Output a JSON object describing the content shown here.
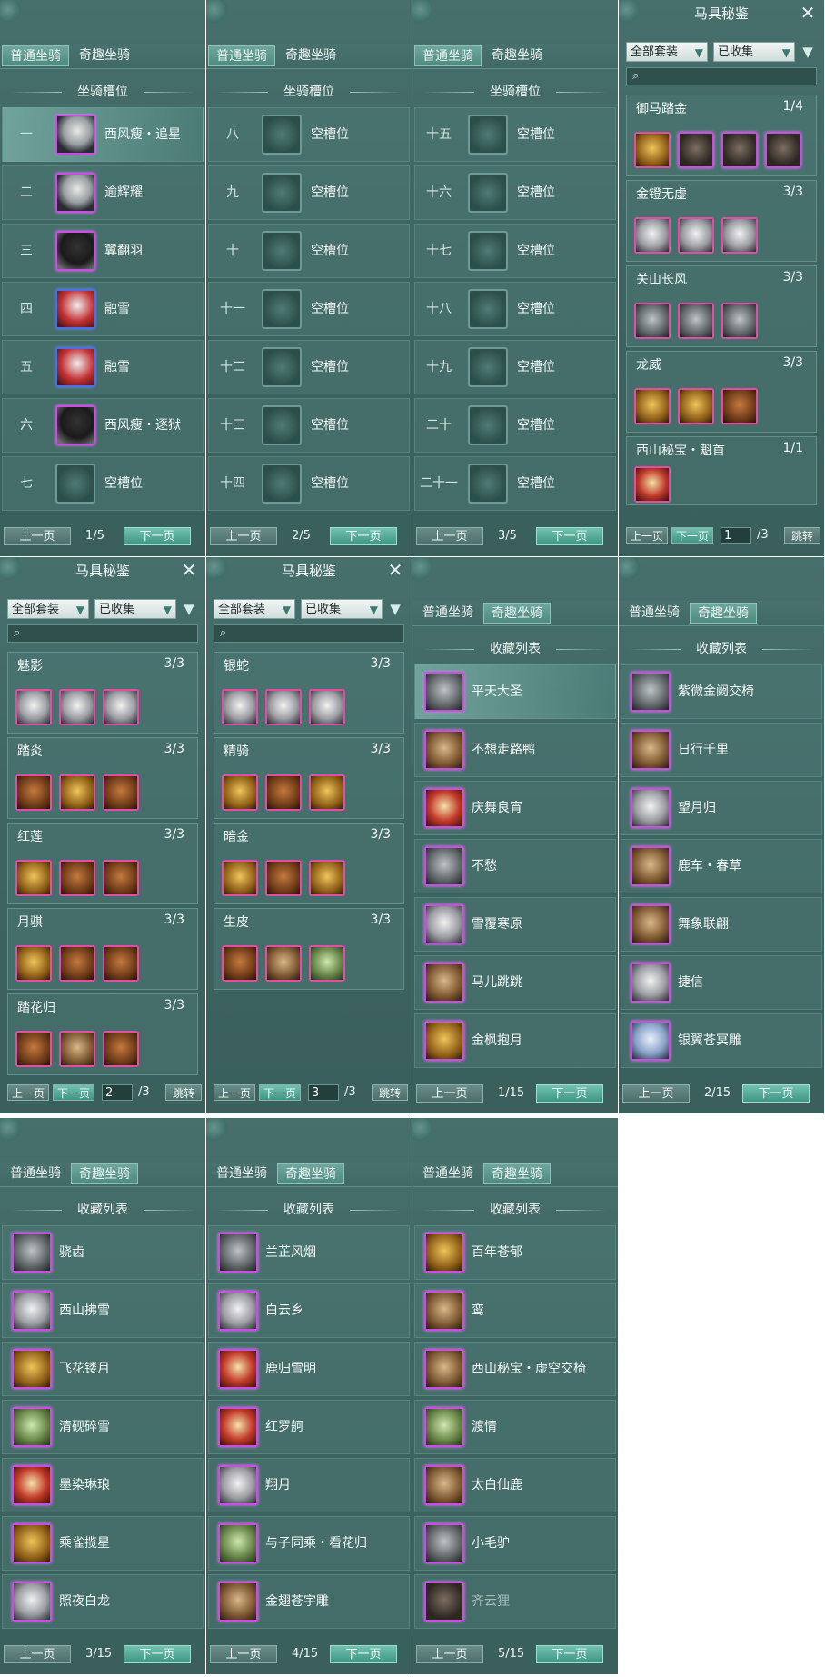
{
  "tabs": {
    "normal": "普通坐骑",
    "special": "奇趣坐骑"
  },
  "slot_title": "坐骑槽位",
  "collection_title": "收藏列表",
  "codex_title": "马具秘鉴",
  "pager": {
    "prev": "上一页",
    "next": "下一页",
    "jump": "跳转"
  },
  "filters": {
    "set": "全部套装",
    "owned": "已收集"
  },
  "slot_pages": [
    {
      "page": "1/5",
      "rows": [
        {
          "idx": "一",
          "name": "西风瘦・追星",
          "icon": "horse-w",
          "frame": "purple"
        },
        {
          "idx": "二",
          "name": "逾辉耀",
          "icon": "horse-w",
          "frame": "purple"
        },
        {
          "idx": "三",
          "name": "翼翻羽",
          "icon": "horse-b",
          "frame": "purple"
        },
        {
          "idx": "四",
          "name": "融雪",
          "icon": "horse-r",
          "frame": "blue"
        },
        {
          "idx": "五",
          "name": "融雪",
          "icon": "horse-r",
          "frame": "blue"
        },
        {
          "idx": "六",
          "name": "西风瘦・逐狱",
          "icon": "horse-b",
          "frame": "purple"
        },
        {
          "idx": "七",
          "name": "空槽位",
          "icon": "empty",
          "frame": "empty"
        }
      ]
    },
    {
      "page": "2/5",
      "rows": [
        {
          "idx": "八",
          "name": "空槽位",
          "icon": "empty",
          "frame": "empty"
        },
        {
          "idx": "九",
          "name": "空槽位",
          "icon": "empty",
          "frame": "empty"
        },
        {
          "idx": "十",
          "name": "空槽位",
          "icon": "empty",
          "frame": "empty"
        },
        {
          "idx": "十一",
          "name": "空槽位",
          "icon": "empty",
          "frame": "empty"
        },
        {
          "idx": "十二",
          "name": "空槽位",
          "icon": "empty",
          "frame": "empty"
        },
        {
          "idx": "十三",
          "name": "空槽位",
          "icon": "empty",
          "frame": "empty"
        },
        {
          "idx": "十四",
          "name": "空槽位",
          "icon": "empty",
          "frame": "empty"
        }
      ]
    },
    {
      "page": "3/5",
      "rows": [
        {
          "idx": "十五",
          "name": "空槽位",
          "icon": "empty",
          "frame": "empty"
        },
        {
          "idx": "十六",
          "name": "空槽位",
          "icon": "empty",
          "frame": "empty"
        },
        {
          "idx": "十七",
          "name": "空槽位",
          "icon": "empty",
          "frame": "empty"
        },
        {
          "idx": "十八",
          "name": "空槽位",
          "icon": "empty",
          "frame": "empty"
        },
        {
          "idx": "十九",
          "name": "空槽位",
          "icon": "empty",
          "frame": "empty"
        },
        {
          "idx": "二十",
          "name": "空槽位",
          "icon": "empty",
          "frame": "empty"
        },
        {
          "idx": "二十一",
          "name": "空槽位",
          "icon": "empty",
          "frame": "empty"
        }
      ]
    }
  ],
  "codex_pages": [
    {
      "page_input": "1",
      "total": "/3",
      "sets": [
        {
          "name": "御马踏金",
          "count": "1/4",
          "items": [
            "gold",
            "dark",
            "dark",
            "dark"
          ]
        },
        {
          "name": "金镫无虚",
          "count": "3/3",
          "items": [
            "silver",
            "silver",
            "silver"
          ]
        },
        {
          "name": "关山长风",
          "count": "3/3",
          "items": [
            "grey",
            "grey",
            "grey"
          ]
        },
        {
          "name": "龙威",
          "count": "3/3",
          "items": [
            "gold",
            "gold",
            "leather"
          ]
        },
        {
          "name": "西山秘宝・魁首",
          "count": "1/1",
          "items": [
            "red"
          ]
        }
      ]
    },
    {
      "page_input": "2",
      "total": "/3",
      "sets": [
        {
          "name": "魅影",
          "count": "3/3",
          "items": [
            "silver",
            "silver",
            "silver"
          ]
        },
        {
          "name": "踏炎",
          "count": "3/3",
          "items": [
            "leather",
            "gold",
            "leather"
          ]
        },
        {
          "name": "红莲",
          "count": "3/3",
          "items": [
            "gold",
            "leather",
            "leather"
          ]
        },
        {
          "name": "月骐",
          "count": "3/3",
          "items": [
            "gold",
            "leather",
            "leather"
          ]
        },
        {
          "name": "踏花归",
          "count": "3/3",
          "items": [
            "leather",
            "brown",
            "leather"
          ]
        }
      ]
    },
    {
      "page_input": "3",
      "total": "/3",
      "sets": [
        {
          "name": "银蛇",
          "count": "3/3",
          "items": [
            "silver",
            "silver",
            "silver"
          ]
        },
        {
          "name": "精骑",
          "count": "3/3",
          "items": [
            "gold",
            "leather",
            "gold"
          ]
        },
        {
          "name": "暗金",
          "count": "3/3",
          "items": [
            "gold",
            "leather",
            "gold"
          ]
        },
        {
          "name": "生皮",
          "count": "3/3",
          "items": [
            "leather",
            "brown",
            "green"
          ]
        }
      ]
    }
  ],
  "collection_pages": [
    {
      "page": "1/15",
      "rows": [
        {
          "name": "平天大圣",
          "icon": "grey"
        },
        {
          "name": "不想走路鸭",
          "icon": "brown"
        },
        {
          "name": "庆舞良宵",
          "icon": "red"
        },
        {
          "name": "不愁",
          "icon": "grey"
        },
        {
          "name": "雪覆寒原",
          "icon": "silver"
        },
        {
          "name": "马儿跳跳",
          "icon": "brown"
        },
        {
          "name": "金枫抱月",
          "icon": "gold"
        }
      ]
    },
    {
      "page": "2/15",
      "rows": [
        {
          "name": "紫微金阙交椅",
          "icon": "grey"
        },
        {
          "name": "日行千里",
          "icon": "brown"
        },
        {
          "name": "望月归",
          "icon": "silver"
        },
        {
          "name": "鹿车・春草",
          "icon": "brown"
        },
        {
          "name": "舞象联翩",
          "icon": "brown"
        },
        {
          "name": "捷信",
          "icon": "silver"
        },
        {
          "name": "银翼苍冥雕",
          "icon": "blue"
        }
      ]
    },
    {
      "page": "3/15",
      "rows": [
        {
          "name": "骁齿",
          "icon": "grey"
        },
        {
          "name": "西山拂雪",
          "icon": "silver"
        },
        {
          "name": "飞花镂月",
          "icon": "gold"
        },
        {
          "name": "清砚碎雪",
          "icon": "green"
        },
        {
          "name": "墨染琳琅",
          "icon": "red"
        },
        {
          "name": "乘雀揽星",
          "icon": "gold"
        },
        {
          "name": "照夜白龙",
          "icon": "silver"
        }
      ]
    },
    {
      "page": "4/15",
      "rows": [
        {
          "name": "兰芷风烟",
          "icon": "grey"
        },
        {
          "name": "白云乡",
          "icon": "silver"
        },
        {
          "name": "鹿归雪明",
          "icon": "red"
        },
        {
          "name": "红罗舸",
          "icon": "red"
        },
        {
          "name": "翔月",
          "icon": "silver"
        },
        {
          "name": "与子同乘・看花归",
          "icon": "green"
        },
        {
          "name": "金翅苍宇雕",
          "icon": "brown"
        }
      ]
    },
    {
      "page": "5/15",
      "rows": [
        {
          "name": "百年苍郁",
          "icon": "gold"
        },
        {
          "name": "鸾",
          "icon": "brown"
        },
        {
          "name": "西山秘宝・虚空交椅",
          "icon": "brown"
        },
        {
          "name": "渡情",
          "icon": "green"
        },
        {
          "name": "太白仙鹿",
          "icon": "brown"
        },
        {
          "name": "小毛驴",
          "icon": "grey"
        },
        {
          "name": "齐云狸",
          "icon": "dark",
          "dim": true
        }
      ]
    }
  ]
}
